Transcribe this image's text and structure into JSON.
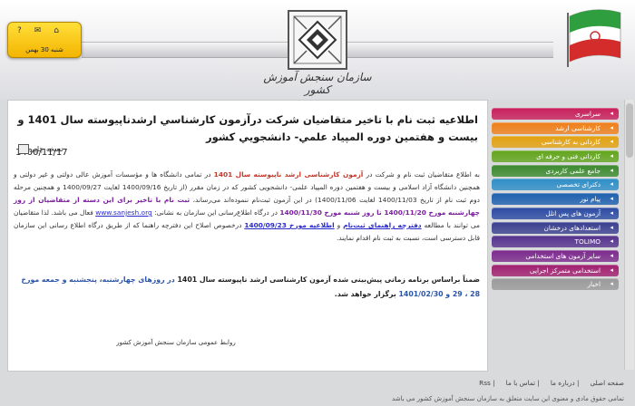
{
  "header": {
    "date_text": "شنبه 30 بهمن",
    "logo_text": "سازمان سنجش آموزش کشور"
  },
  "article": {
    "title": "اطلاعیه ثبت نام با تاخیر متقاضیان شرکت درآزمون کارشناسي ارشدناپيوسته سال 1401 و بیست و هفتمین دوره المپیاد علمي- دانشجويي كشور",
    "print_label": "نسخه چاپی",
    "date": "1400/11/17",
    "p1": {
      "a": "به اطلاع متقاضیان ثبت نام و شرکت در ",
      "b": "آزمون کارشناسی ارشد ناپیوسته سال 1401",
      "c": " در تمامی دانشگاه ها و مؤسسات آموزش عالی دولتی و غیر دولتی و همچنین دانشگاه آزاد اسلامی و بیست و هفتمین دوره المپیاد علمی- دانشجویی کشور که در زمان مقرر (از تاریخ 1400/09/16 لغایت 1400/09/27 و همچنین مرحله دوم ثبت نام از تاریخ 1400/11/03 لغایت 1400/11/06) در این آزمون ثبت‌نام ننموده‌اند می‌رساند، ",
      "d": "ثبت نام با تاخیر برای این دسته از متقاضیان از روز چهارشنبه مورخ 1400/11/20 تا روز شنبه مورخ 1400/11/30",
      "e": " در درگاه اطلاع‌رسانی این سازمان به نشانی: ",
      "f": "www.sanjesh.org",
      "g": " فعال می باشد. لذا متقاضیان می توانند با مطالعه ",
      "h": "دفترچه راهنمای ثبت‌نام",
      "i": " و ",
      "j": "اطلاعیه مورخ 1400/09/23",
      "k": " درخصوص اصلاح این دفترچه راهنما که از طریق درگاه اطلاع رسانی این سازمان قابل دسترسی است، نسبت به ثبت نام اقدام نمایند."
    },
    "note": {
      "a": "ضمناً براساس برنامه زمانی پیش‌بینی شده آزمون کارشناسی ارشد ناپیوسته سال 1401 ",
      "b": "در روزهای چهارشنبه، پنجشنبه و جمعه مورخ 28 ، 29 و 1401/02/30",
      "c": " برگزار خواهد شد."
    },
    "signature": "روابط عمومی سازمان سنجش آموزش کشور"
  },
  "sidebar": {
    "items": [
      {
        "label": "سراسری",
        "color": "#c81e5a"
      },
      {
        "label": "کارشناسی ارشد",
        "color": "#ef7f1a"
      },
      {
        "label": "کاردانی به کارشناسی",
        "color": "#e3a10f"
      },
      {
        "label": "کاردانی فنی و حرفه ای",
        "color": "#62a51c"
      },
      {
        "label": "جامع علمی کاربردی",
        "color": "#3c8a2e"
      },
      {
        "label": "دکترای تخصصی",
        "color": "#2d8ec7"
      },
      {
        "label": "پیام نور",
        "color": "#1d5fae"
      },
      {
        "label": "آزمون های پس اتلل",
        "color": "#2b4aa3"
      },
      {
        "label": "استعدادهای درخشان",
        "color": "#3a3f8f"
      },
      {
        "label": "TOLIMO",
        "color": "#55328d"
      },
      {
        "label": "سایر آزمون های استخدامی",
        "color": "#7b2a8c"
      },
      {
        "label": "استخدامی متمرکز اجرایی",
        "color": "#a01f6f"
      },
      {
        "label": "اخبار",
        "color": "#9a9a9a"
      }
    ]
  },
  "footer": {
    "links": [
      "صفحه اصلی",
      "درباره ما",
      "تماس با ما",
      "Rss"
    ],
    "copyright": "تمامی حقوق مادی و معنوی این سایت متعلق به سازمان سنجش آموزش کشور می باشد"
  }
}
